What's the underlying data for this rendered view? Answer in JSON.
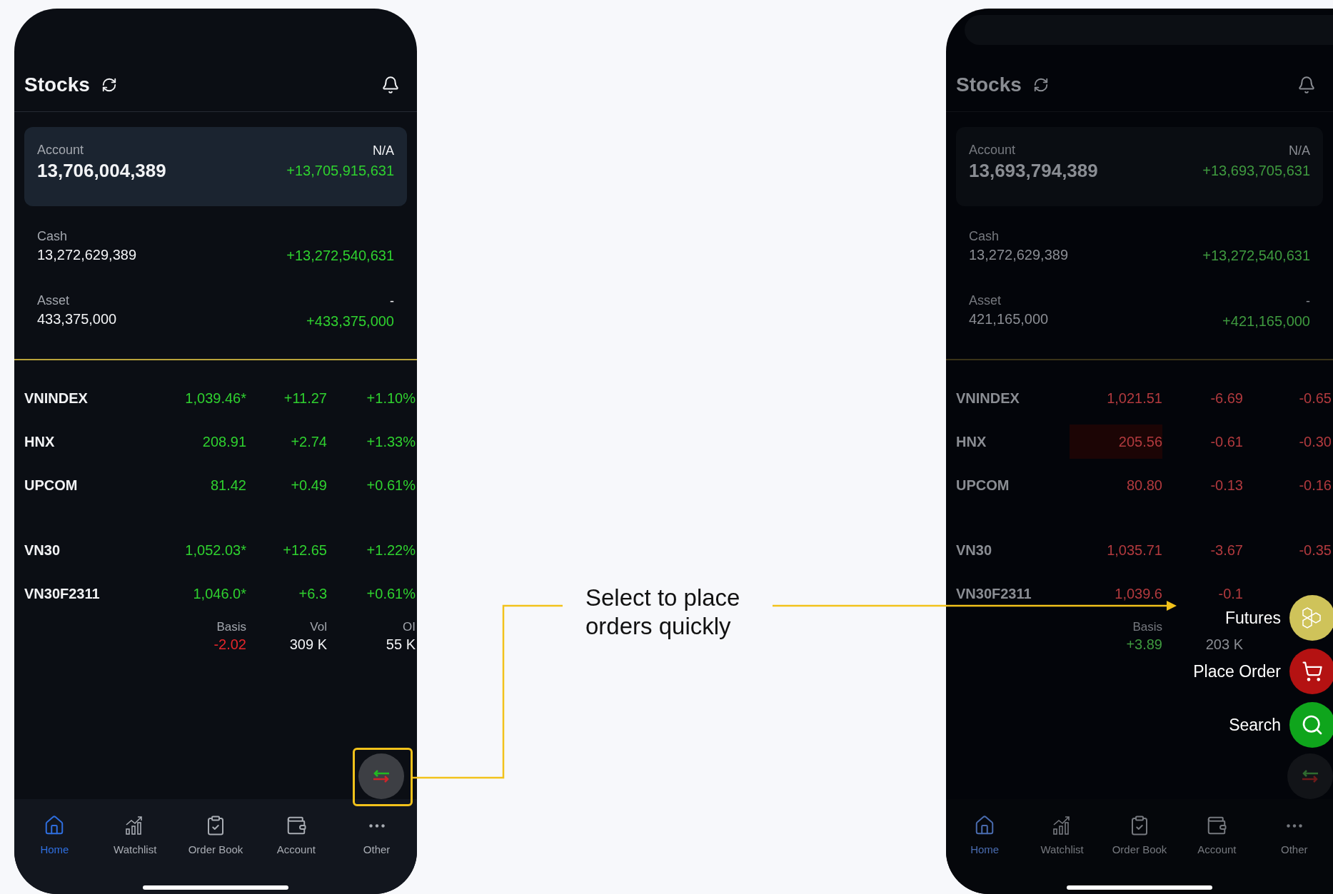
{
  "caption": "Select to place orders quickly",
  "phones": [
    {
      "dimmed": false,
      "title": "Stocks",
      "summary": [
        {
          "kind": "card",
          "label": "Account",
          "value": "13,706,004,389",
          "note": "N/A",
          "change": "+13,705,915,631"
        },
        {
          "kind": "row",
          "label": "Cash",
          "value": "13,272,629,389",
          "change": "+13,272,540,631"
        },
        {
          "kind": "row",
          "label": "Asset",
          "value": "433,375,000",
          "note": "-",
          "change": "+433,375,000"
        }
      ],
      "index_groups": [
        [
          {
            "name": "VNINDEX",
            "price": "1,039.46*",
            "change": "+11.27",
            "percent": "+1.10%",
            "positive": true,
            "highlighted": false
          },
          {
            "name": "HNX",
            "price": "208.91",
            "change": "+2.74",
            "percent": "+1.33%",
            "positive": true,
            "highlighted": false
          },
          {
            "name": "UPCOM",
            "price": "81.42",
            "change": "+0.49",
            "percent": "+0.61%",
            "positive": true,
            "highlighted": false
          }
        ],
        [
          {
            "name": "VN30",
            "price": "1,052.03*",
            "change": "+12.65",
            "percent": "+1.22%",
            "positive": true,
            "highlighted": false
          },
          {
            "name": "VN30F2311",
            "price": "1,046.0*",
            "change": "+6.3",
            "percent": "+0.61%",
            "positive": true,
            "highlighted": false
          }
        ]
      ],
      "futures_stats": {
        "basis_label": "Basis",
        "basis": "-2.02",
        "basis_positive": false,
        "vol_label": "Vol",
        "vol": "309 K",
        "oi_label": "OI",
        "oi": "55 K"
      },
      "nav": [
        {
          "label": "Home",
          "selected": true
        },
        {
          "label": "Watchlist",
          "selected": false
        },
        {
          "label": "Order Book",
          "selected": false
        },
        {
          "label": "Account",
          "selected": false
        },
        {
          "label": "Other",
          "selected": false
        }
      ]
    },
    {
      "dimmed": true,
      "title": "Stocks",
      "summary": [
        {
          "kind": "card",
          "label": "Account",
          "value": "13,693,794,389",
          "note": "N/A",
          "change": "+13,693,705,631"
        },
        {
          "kind": "row",
          "label": "Cash",
          "value": "13,272,629,389",
          "change": "+13,272,540,631"
        },
        {
          "kind": "row",
          "label": "Asset",
          "value": "421,165,000",
          "note": "-",
          "change": "+421,165,000"
        }
      ],
      "index_groups": [
        [
          {
            "name": "VNINDEX",
            "price": "1,021.51",
            "change": "-6.69",
            "percent": "-0.65",
            "positive": false,
            "highlighted": false
          },
          {
            "name": "HNX",
            "price": "205.56",
            "change": "-0.61",
            "percent": "-0.30",
            "positive": false,
            "highlighted": true
          },
          {
            "name": "UPCOM",
            "price": "80.80",
            "change": "-0.13",
            "percent": "-0.16",
            "positive": false,
            "highlighted": false
          }
        ],
        [
          {
            "name": "VN30",
            "price": "1,035.71",
            "change": "-3.67",
            "percent": "-0.35",
            "positive": false,
            "highlighted": false
          },
          {
            "name": "VN30F2311",
            "price": "1,039.6",
            "change": "-0.1",
            "positive": false,
            "highlighted": false
          }
        ]
      ],
      "futures_stats": {
        "basis_label": "Basis",
        "basis": "+3.89",
        "basis_positive": true,
        "vol": "203 K"
      },
      "speed_dial": [
        {
          "kind": "futures",
          "label": "Futures",
          "color": "#cfc35a"
        },
        {
          "kind": "order",
          "label": "Place Order",
          "color": "#b41212"
        },
        {
          "kind": "search",
          "label": "Search",
          "color": "#0fa51c"
        }
      ],
      "nav": [
        {
          "label": "Home",
          "selected": true
        },
        {
          "label": "Watchlist",
          "selected": false
        },
        {
          "label": "Order Book",
          "selected": false
        },
        {
          "label": "Account",
          "selected": false
        },
        {
          "label": "Other",
          "selected": false
        }
      ]
    }
  ]
}
